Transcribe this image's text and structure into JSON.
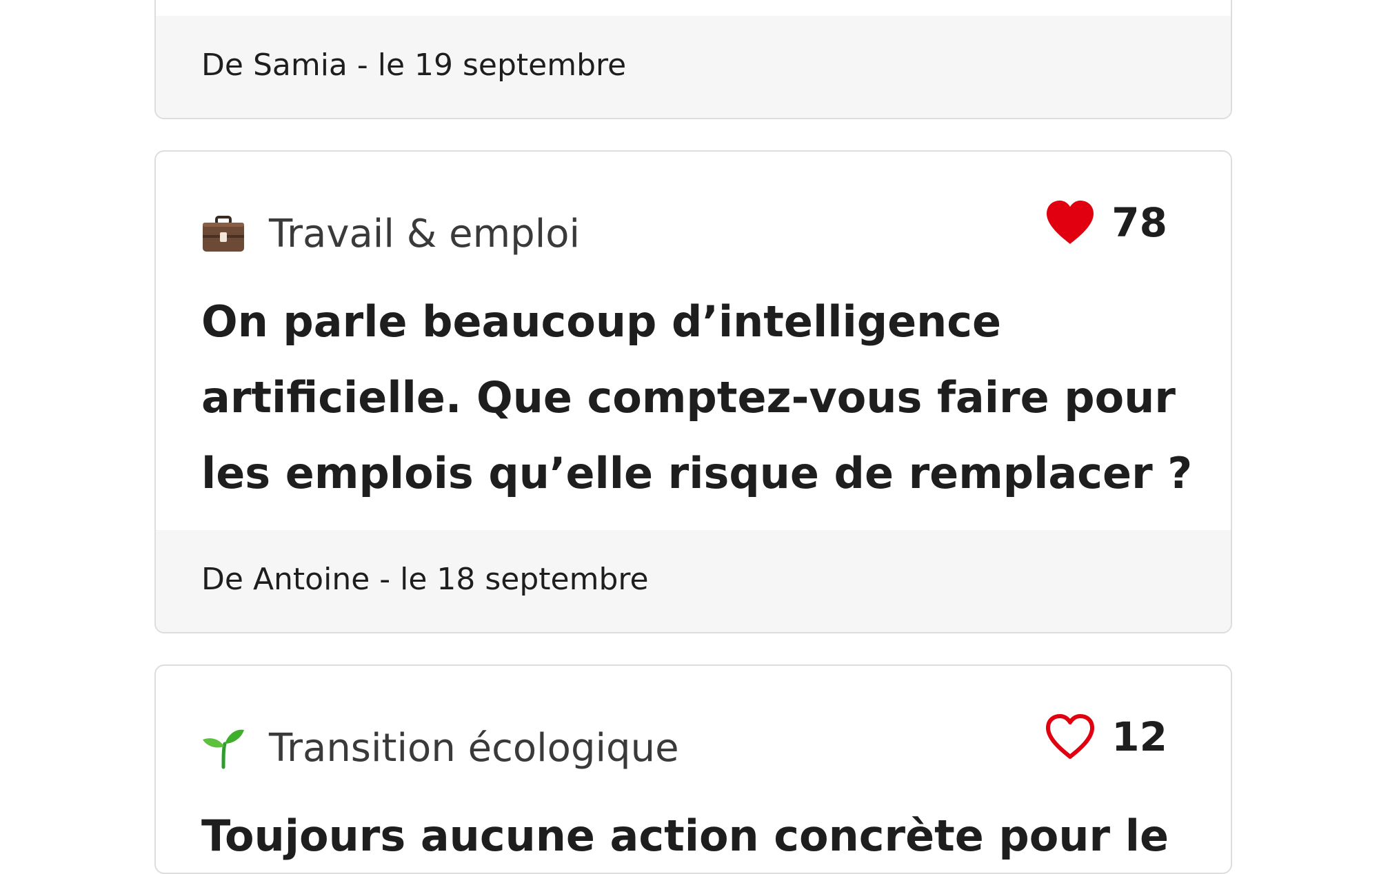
{
  "cards": [
    {
      "author_line": "De Samia - le 19 septembre"
    },
    {
      "category": {
        "icon": "briefcase-icon",
        "label": "Travail & emploi"
      },
      "likes": {
        "count": "78",
        "liked": true,
        "color": "#e1000f"
      },
      "question": "On parle beaucoup d’intelligence artificielle. Que comptez-vous faire pour les emplois qu’elle risque de remplacer ?",
      "author_line": "De Antoine - le 18 septembre"
    },
    {
      "category": {
        "icon": "seedling-icon",
        "label": "Transition écologique"
      },
      "likes": {
        "count": "12",
        "liked": false,
        "color": "#e1000f"
      },
      "question": "Toujours aucune action concrète pour le"
    }
  ]
}
